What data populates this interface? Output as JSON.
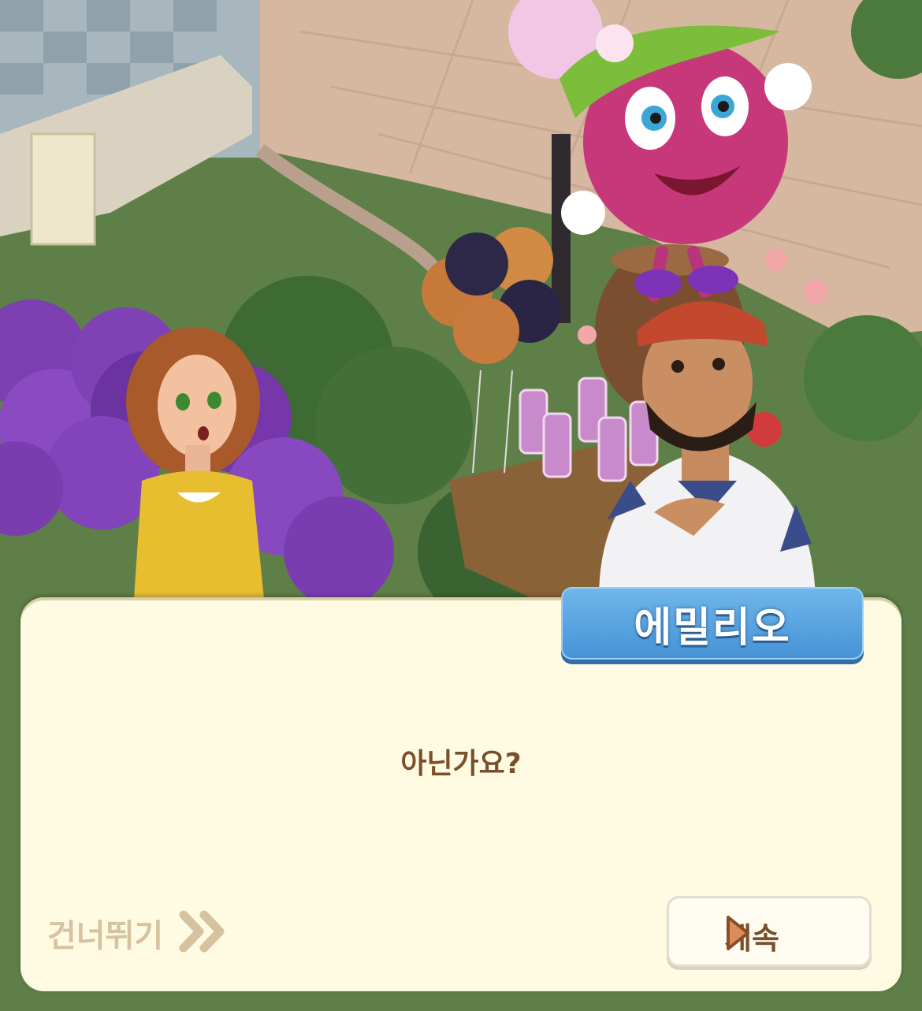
{
  "dialog": {
    "speaker_name": "에밀리오",
    "text": "아닌가요?",
    "skip_label": "건너뛰기",
    "continue_label": "계속"
  },
  "colors": {
    "dialog_bg": "#fffbe3",
    "name_tag": "#4f9ee0",
    "text_brown": "#7a4f2b",
    "skip_text": "#d7c2a0",
    "continue_arrow": "#d98d57"
  },
  "icons": {
    "skip": "double-chevron-right-icon",
    "continue": "play-triangle-icon"
  }
}
